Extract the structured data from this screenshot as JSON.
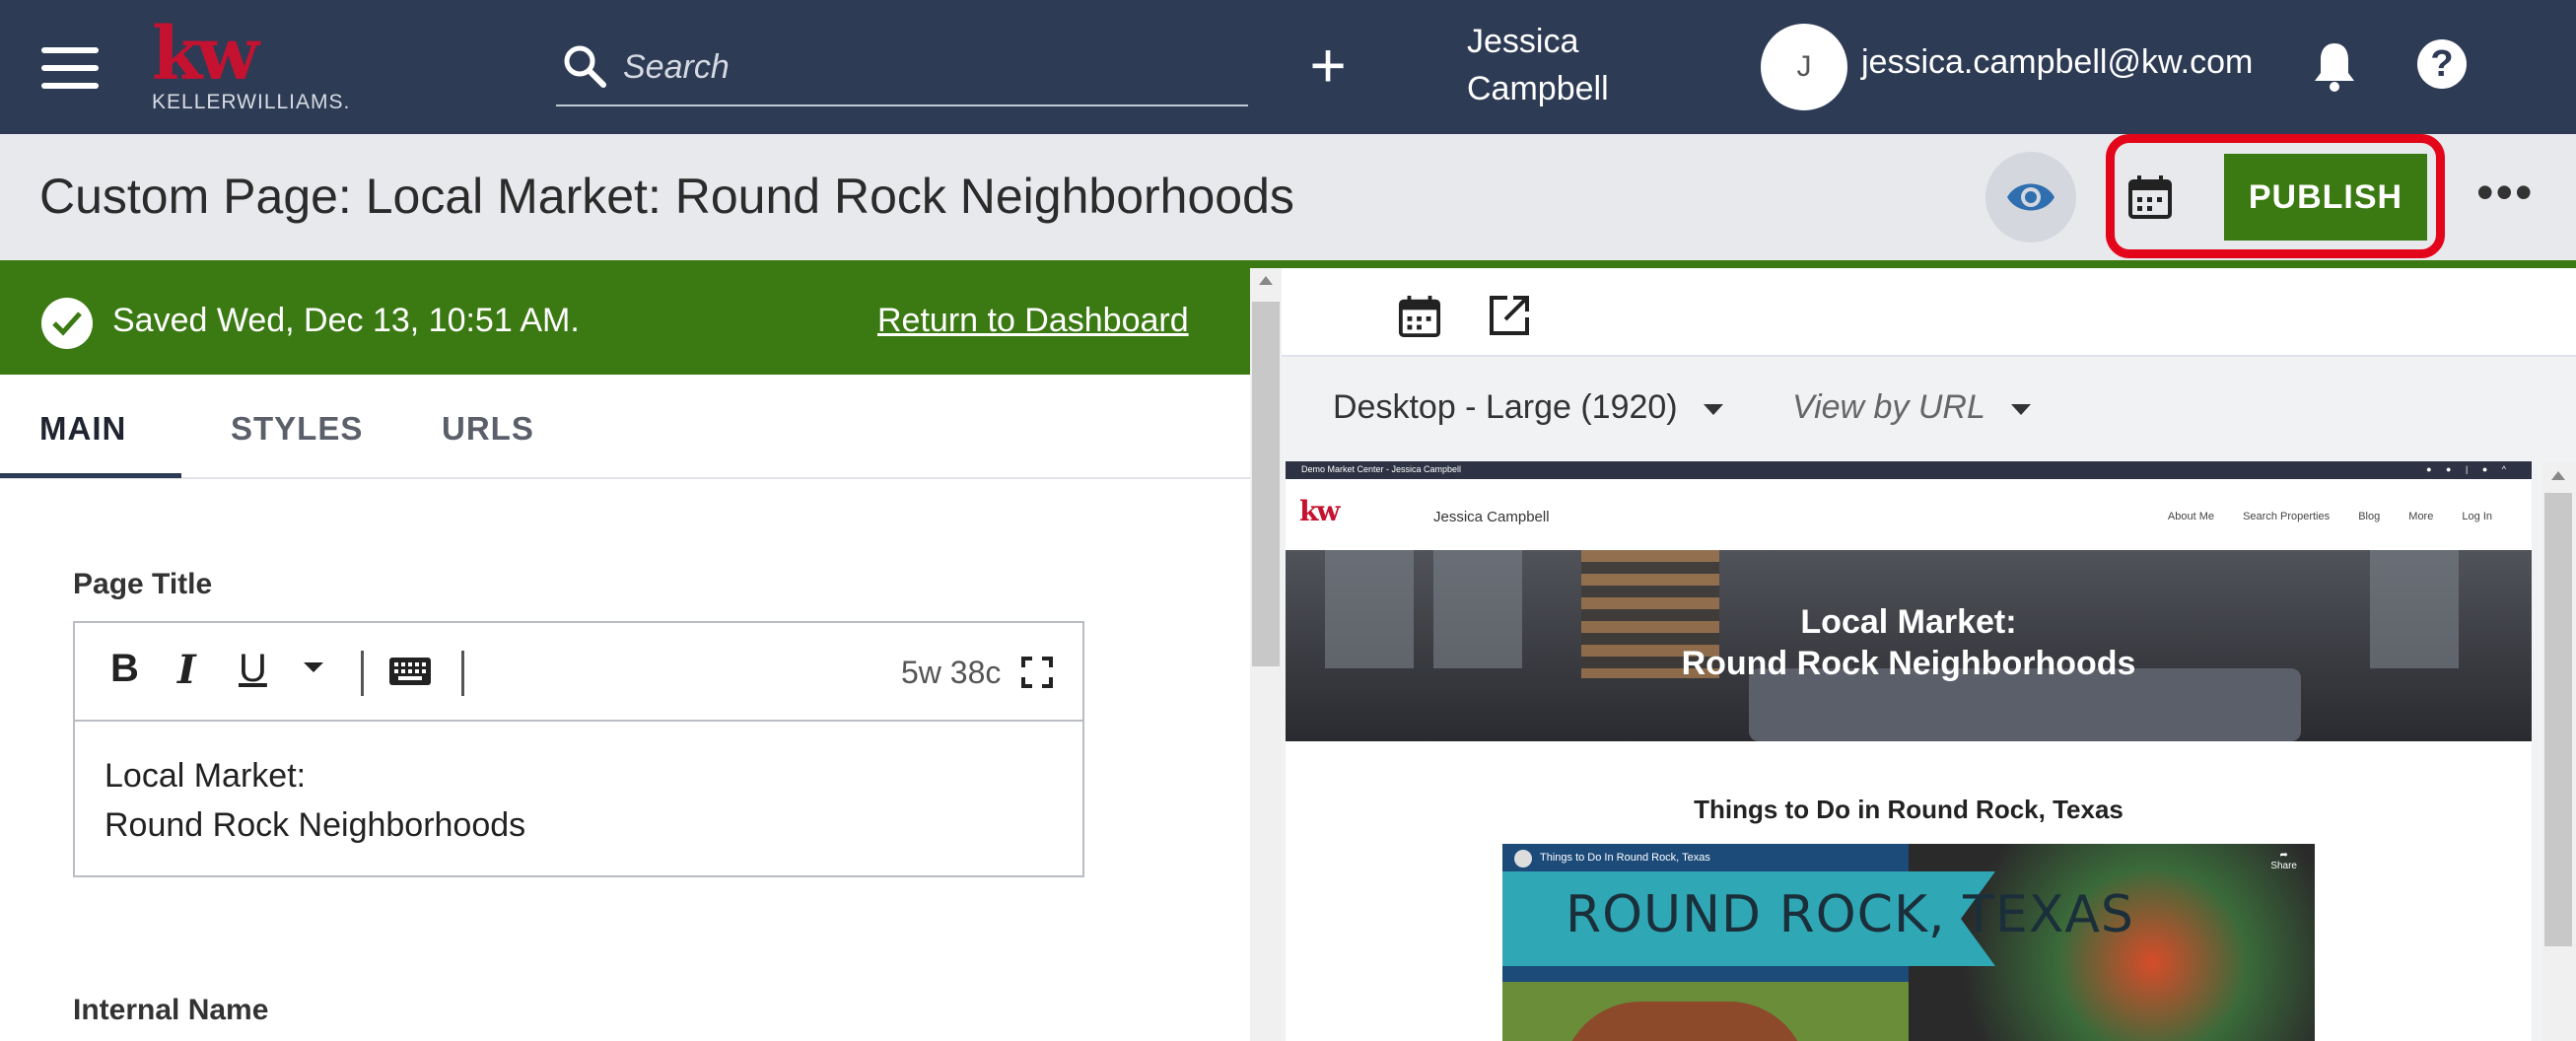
{
  "header": {
    "logo_text": "kw",
    "logo_subtext": "KELLERWILLIAMS.",
    "search_placeholder": "Search",
    "user_first": "Jessica",
    "user_last": "Campbell",
    "avatar_initial": "J",
    "email": "jessica.campbell@kw.com",
    "help_glyph": "?"
  },
  "page_header": {
    "title": "Custom Page: Local Market: Round Rock Neighborhoods",
    "publish_label": "PUBLISH",
    "more_glyph": "•••"
  },
  "status": {
    "saved_text": "Saved Wed, Dec 13, 10:51 AM.",
    "return_link": "Return to Dashboard"
  },
  "tabs": [
    {
      "label": "MAIN",
      "active": true
    },
    {
      "label": "STYLES",
      "active": false
    },
    {
      "label": "URLS",
      "active": false
    }
  ],
  "form": {
    "page_title_label": "Page Title",
    "toolbar": {
      "bold": "B",
      "italic": "I",
      "underline": "U",
      "count": "5w 38c"
    },
    "page_title_line1": "Local Market:",
    "page_title_line2": "Round Rock Neighborhoods",
    "internal_name_label": "Internal Name"
  },
  "preview_controls": {
    "device": "Desktop - Large (1920)",
    "view_by_url": "View by URL"
  },
  "preview": {
    "topstrip_text": "Demo Market Center - Jessica Campbell",
    "logo": "kw",
    "agent_name": "Jessica Campbell",
    "nav_links": [
      "About Me",
      "Search Properties",
      "Blog",
      "More",
      "Log In"
    ],
    "hero_line1": "Local Market:",
    "hero_line2": "Round Rock Neighborhoods",
    "section_title": "Things to Do in Round Rock, Texas",
    "video_title": "Things to Do In Round Rock, Texas",
    "video_banner": "ROUND ROCK, TEXAS",
    "share_label": "Share"
  },
  "colors": {
    "navbar": "#2d3b55",
    "brand_red": "#c51230",
    "publish_green": "#3b7a12",
    "highlight_red": "#e3061a"
  },
  "icons": [
    "menu-icon",
    "search-icon",
    "plus-icon",
    "bell-icon",
    "help-icon",
    "eye-icon",
    "calendar-icon",
    "more-icon",
    "check-circle-icon",
    "keyboard-icon",
    "fullscreen-icon",
    "external-link-icon",
    "chevron-down-icon"
  ]
}
